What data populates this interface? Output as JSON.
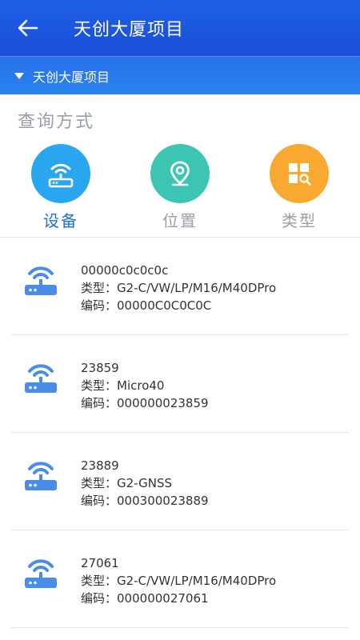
{
  "app_bar": {
    "title": "天创大厦项目"
  },
  "project_selector": {
    "label": "天创大厦项目"
  },
  "query": {
    "title": "查询方式"
  },
  "query_modes": [
    {
      "label": "设备",
      "color": "#2aa5f0",
      "active": true
    },
    {
      "label": "位置",
      "color": "#3cc5b3",
      "active": false
    },
    {
      "label": "类型",
      "color": "#f9a830",
      "active": false
    }
  ],
  "field_labels": {
    "type": "类型：",
    "code": "编码："
  },
  "devices": [
    {
      "name": "00000c0c0c0c",
      "type": "G2-C/VW/LP/M16/M40DPro",
      "code": "00000C0C0C0C"
    },
    {
      "name": "23859",
      "type": "Micro40",
      "code": "000000023859"
    },
    {
      "name": "23889",
      "type": "G2-GNSS",
      "code": "000300023889"
    },
    {
      "name": "27061",
      "type": "G2-C/VW/LP/M16/M40DPro",
      "code": "000000027061"
    }
  ],
  "colors": {
    "app_bar": "#1a4fd8",
    "project_bar": "#2a7ef0",
    "device_icon": "#4a8de8"
  }
}
